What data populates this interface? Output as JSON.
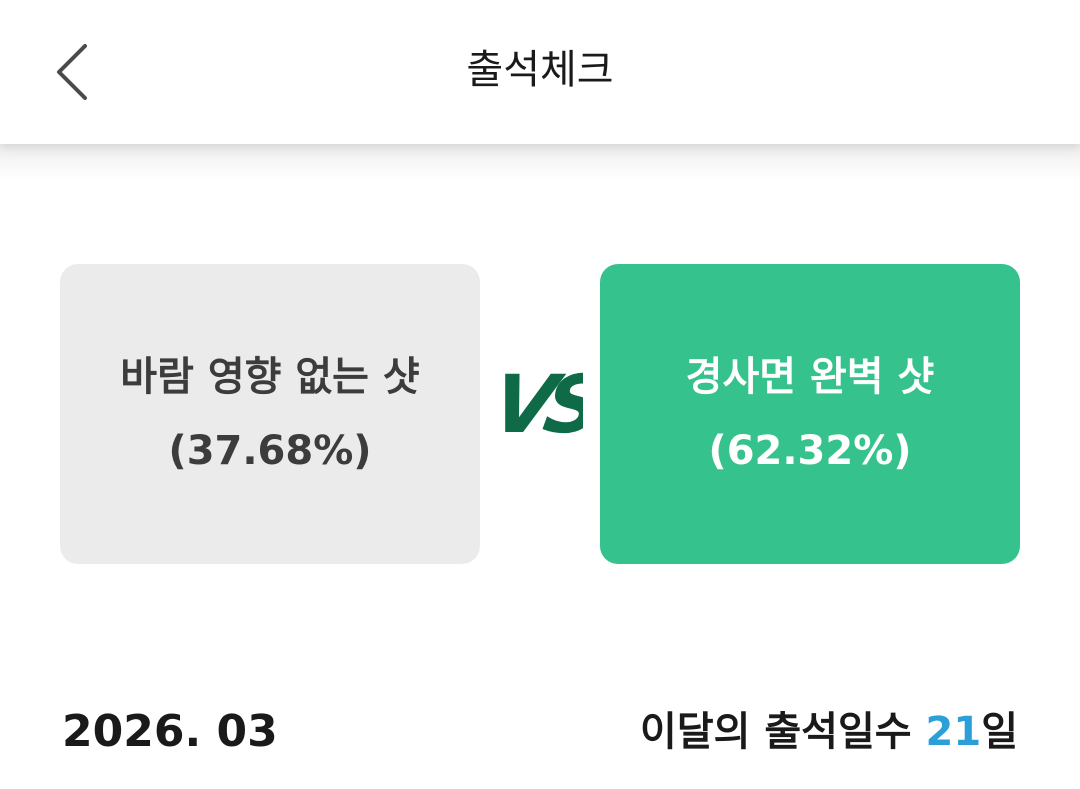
{
  "header": {
    "title": "출석체크",
    "back_icon": "chevron-left-icon"
  },
  "vote": {
    "left": {
      "label": "바람 영향 없는 샷",
      "percent": "(37.68%)",
      "color": "#ebebeb"
    },
    "vs_text": "VS",
    "vs_color": "#0f6b47",
    "right": {
      "label": "경사면 완벽 샷",
      "percent": "(62.32%)",
      "color": "#35c28d"
    }
  },
  "footer": {
    "month": "2026. 03",
    "attendance_label": "이달의 출석일수",
    "attendance_count": "21",
    "attendance_unit": "일",
    "count_color": "#2d9fd8"
  }
}
